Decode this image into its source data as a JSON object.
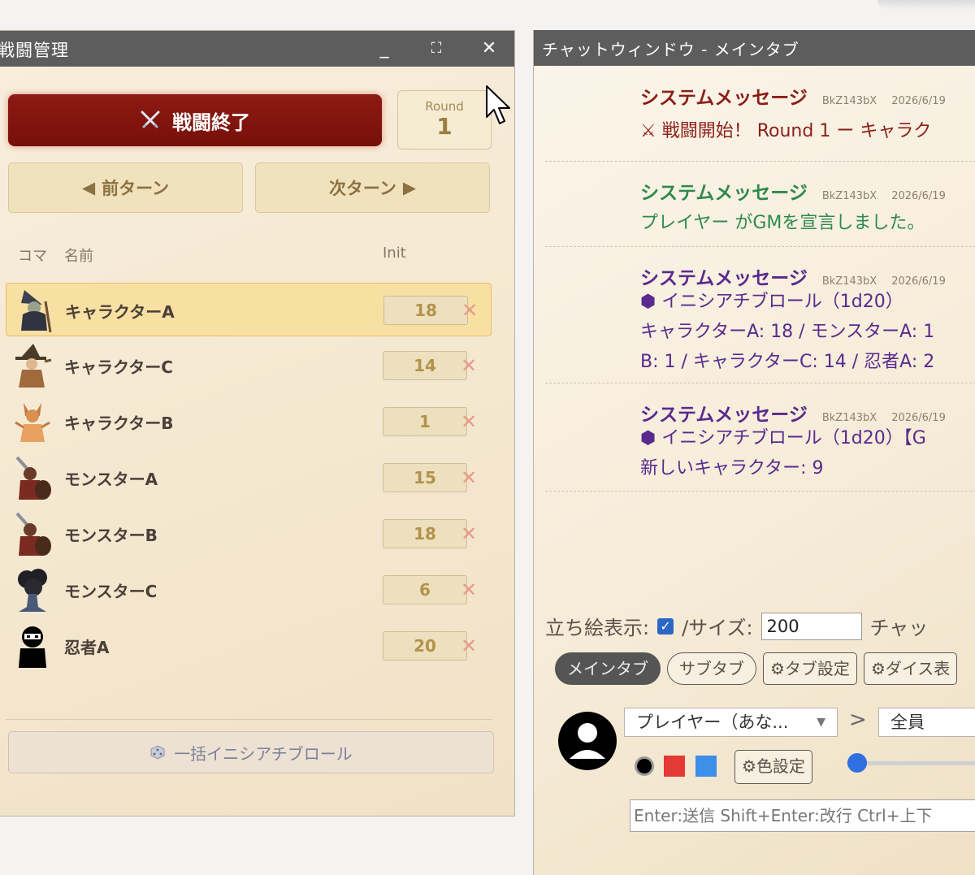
{
  "combat": {
    "title": "戦闘管理",
    "window_buttons": {
      "minimize": "_",
      "maximize": "⛶",
      "close": "✕"
    },
    "end_button": "戦闘終了",
    "round_label": "Round",
    "round_value": "1",
    "prev_turn": "前ターン",
    "next_turn": "次ターン",
    "col_koma": "コマ",
    "col_name": "名前",
    "col_init": "Init",
    "rows": [
      {
        "name": "キャラクターA",
        "init": "18",
        "avatar": "wizard-figure-icon",
        "active": true
      },
      {
        "name": "キャラクターC",
        "init": "14",
        "avatar": "witch-figure-icon"
      },
      {
        "name": "キャラクターB",
        "init": "1",
        "avatar": "fox-figure-icon"
      },
      {
        "name": "モンスターA",
        "init": "15",
        "avatar": "warrior-figure-icon"
      },
      {
        "name": "モンスターB",
        "init": "18",
        "avatar": "warrior-figure-icon"
      },
      {
        "name": "モンスターC",
        "init": "6",
        "avatar": "tree-monster-icon"
      },
      {
        "name": "忍者A",
        "init": "20",
        "avatar": "ninja-icon"
      }
    ],
    "delete_glyph": "✕",
    "bulk_button": "一括イニシアチブロール"
  },
  "chat": {
    "title": "チャットウィンドウ - メインタブ",
    "messages": [
      {
        "sender": "システムメッセージ",
        "id": "BkZ143bX",
        "time": "2026/6/19",
        "sender_color": "#8a1f1a",
        "body_color": "#8a1f1a",
        "lines": [
          "戦闘開始！ Round 1 ー キャラク"
        ]
      },
      {
        "sender": "システムメッセージ",
        "id": "BkZ143bX",
        "time": "2026/6/19",
        "sender_color": "#2e8a4c",
        "body_color": "#2e8a4c",
        "lines": [
          "プレイヤー がGMを宣言しました。"
        ]
      },
      {
        "sender": "システムメッセージ",
        "id": "BkZ143bX",
        "time": "2026/6/19",
        "sender_color": "#5a2a8e",
        "body_color": "#5a2a8e",
        "lines": [
          "イニシアチブロール（1d20）",
          "キャラクターA: 18 / モンスターA: 1",
          "B: 1 / キャラクターC: 14 / 忍者A: 2"
        ]
      },
      {
        "sender": "システムメッセージ",
        "id": "BkZ143bX",
        "time": "2026/6/19",
        "sender_color": "#5a2a8e",
        "body_color": "#5a2a8e",
        "lines": [
          "イニシアチブロール（1d20）【G",
          "新しいキャラクター: 9"
        ]
      }
    ],
    "tachie_label": "立ち絵表示:",
    "size_label": "/サイズ:",
    "size_value": "200",
    "chat_cut_label": "チャッ",
    "tabs": [
      "メインタブ",
      "サブタブ"
    ],
    "tab_settings": "タブ設定",
    "dice_table": "ダイス表",
    "sender_select": "プレイヤー（あな...",
    "arrow": ">",
    "target_select": "全員",
    "color_settings": "色設定",
    "colors": [
      "#000000",
      "#e53935",
      "#3d8fe8"
    ],
    "slider_value": 0,
    "input_placeholder": "Enter:送信 Shift+Enter:改行 Ctrl+上下"
  }
}
